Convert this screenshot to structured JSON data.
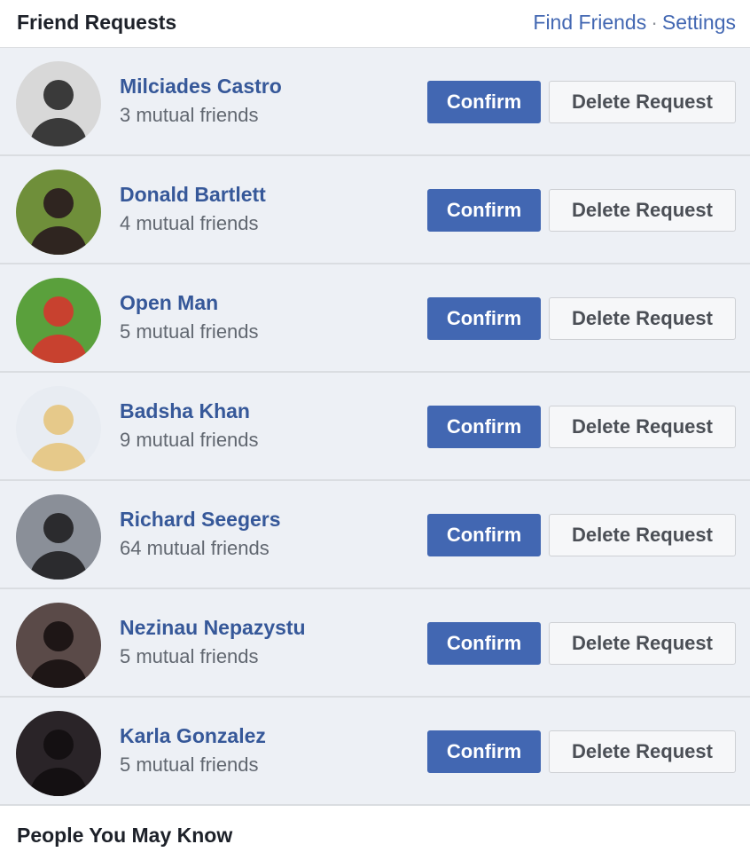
{
  "header": {
    "title": "Friend Requests",
    "find_friends": "Find Friends",
    "separator": "·",
    "settings": "Settings"
  },
  "requests": [
    {
      "name": "Milciades Castro",
      "mutual": "3 mutual friends",
      "confirm": "Confirm",
      "delete": "Delete Request",
      "avatar_colors": [
        "#d8d8d8",
        "#3a3a3a"
      ]
    },
    {
      "name": "Donald Bartlett",
      "mutual": "4 mutual friends",
      "confirm": "Confirm",
      "delete": "Delete Request",
      "avatar_colors": [
        "#6f8f3a",
        "#2f2520"
      ]
    },
    {
      "name": "Open Man",
      "mutual": "5 mutual friends",
      "confirm": "Confirm",
      "delete": "Delete Request",
      "avatar_colors": [
        "#5aa03c",
        "#c8412f"
      ]
    },
    {
      "name": "Badsha Khan",
      "mutual": "9 mutual friends",
      "confirm": "Confirm",
      "delete": "Delete Request",
      "avatar_colors": [
        "#e8ecf2",
        "#e6c98a"
      ]
    },
    {
      "name": "Richard Seegers",
      "mutual": "64 mutual friends",
      "confirm": "Confirm",
      "delete": "Delete Request",
      "avatar_colors": [
        "#8a8f98",
        "#2b2b2e"
      ]
    },
    {
      "name": "Nezinau Nepazystu",
      "mutual": "5 mutual friends",
      "confirm": "Confirm",
      "delete": "Delete Request",
      "avatar_colors": [
        "#5a4a48",
        "#1e1616"
      ]
    },
    {
      "name": "Karla Gonzalez",
      "mutual": "5 mutual friends",
      "confirm": "Confirm",
      "delete": "Delete Request",
      "avatar_colors": [
        "#2a2428",
        "#141012"
      ]
    }
  ],
  "footer": {
    "title": "People You May Know"
  },
  "colors": {
    "accent": "#4267b2",
    "name_link": "#365899",
    "list_background": "#edf0f5"
  }
}
